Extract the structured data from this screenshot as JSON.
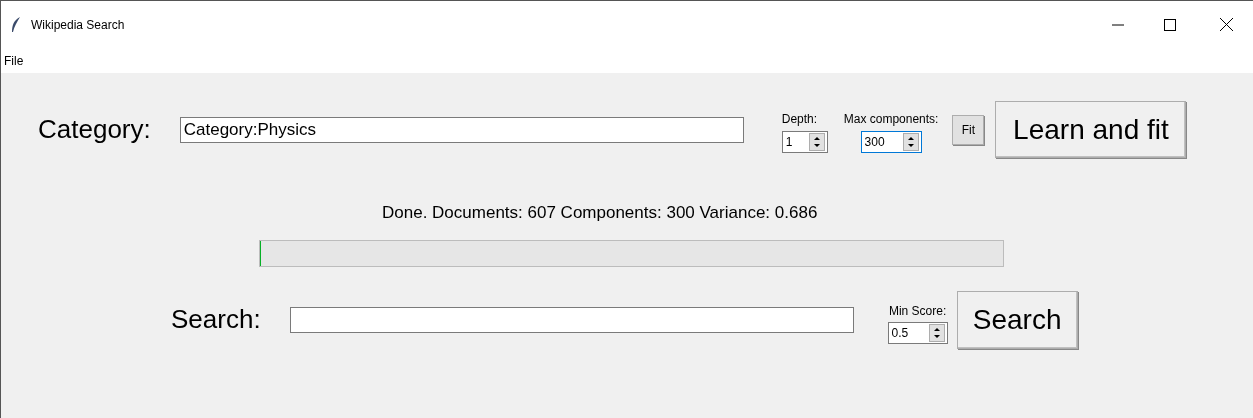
{
  "window": {
    "title": "Wikipedia Search"
  },
  "menu": [
    "File"
  ],
  "category": {
    "label": "Category:",
    "value": "Category:Physics"
  },
  "depth": {
    "label": "Depth:",
    "value": "1",
    "focused": false
  },
  "max_components": {
    "label": "Max components:",
    "value": "300",
    "focused": true
  },
  "fit_button": "Fit",
  "learn_button": "Learn and fit",
  "status": "Done. Documents: 607 Components: 300 Variance: 0.686",
  "progress": {
    "level": 0
  },
  "search": {
    "label": "Search:"
  },
  "min_score": {
    "label": "Min Score:",
    "value": "0.5",
    "focused": false
  },
  "search_button": "Search"
}
